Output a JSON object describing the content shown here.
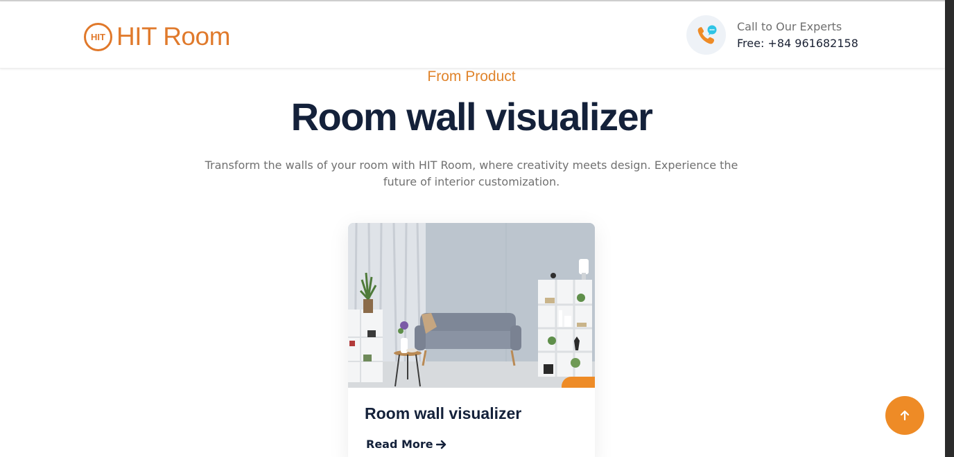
{
  "header": {
    "logo_text": "HIT Room",
    "logo_badge": "HIT",
    "contact_label": "Call to Our Experts",
    "contact_number": "Free: +84 961682158"
  },
  "section": {
    "subtitle": "From Product",
    "title": "Room wall visualizer",
    "description": "Transform the walls of your room with HIT Room, where creativity meets design. Experience the future of interior customization."
  },
  "card": {
    "title": "Room wall visualizer",
    "read_more": "Read More"
  },
  "icons": {
    "phone": "phone-chat-icon",
    "arrow_right": "arrow-right-icon",
    "arrow_up": "arrow-up-icon"
  },
  "colors": {
    "accent": "#ee8b26",
    "heading": "#14213a",
    "body_text": "#707070"
  }
}
